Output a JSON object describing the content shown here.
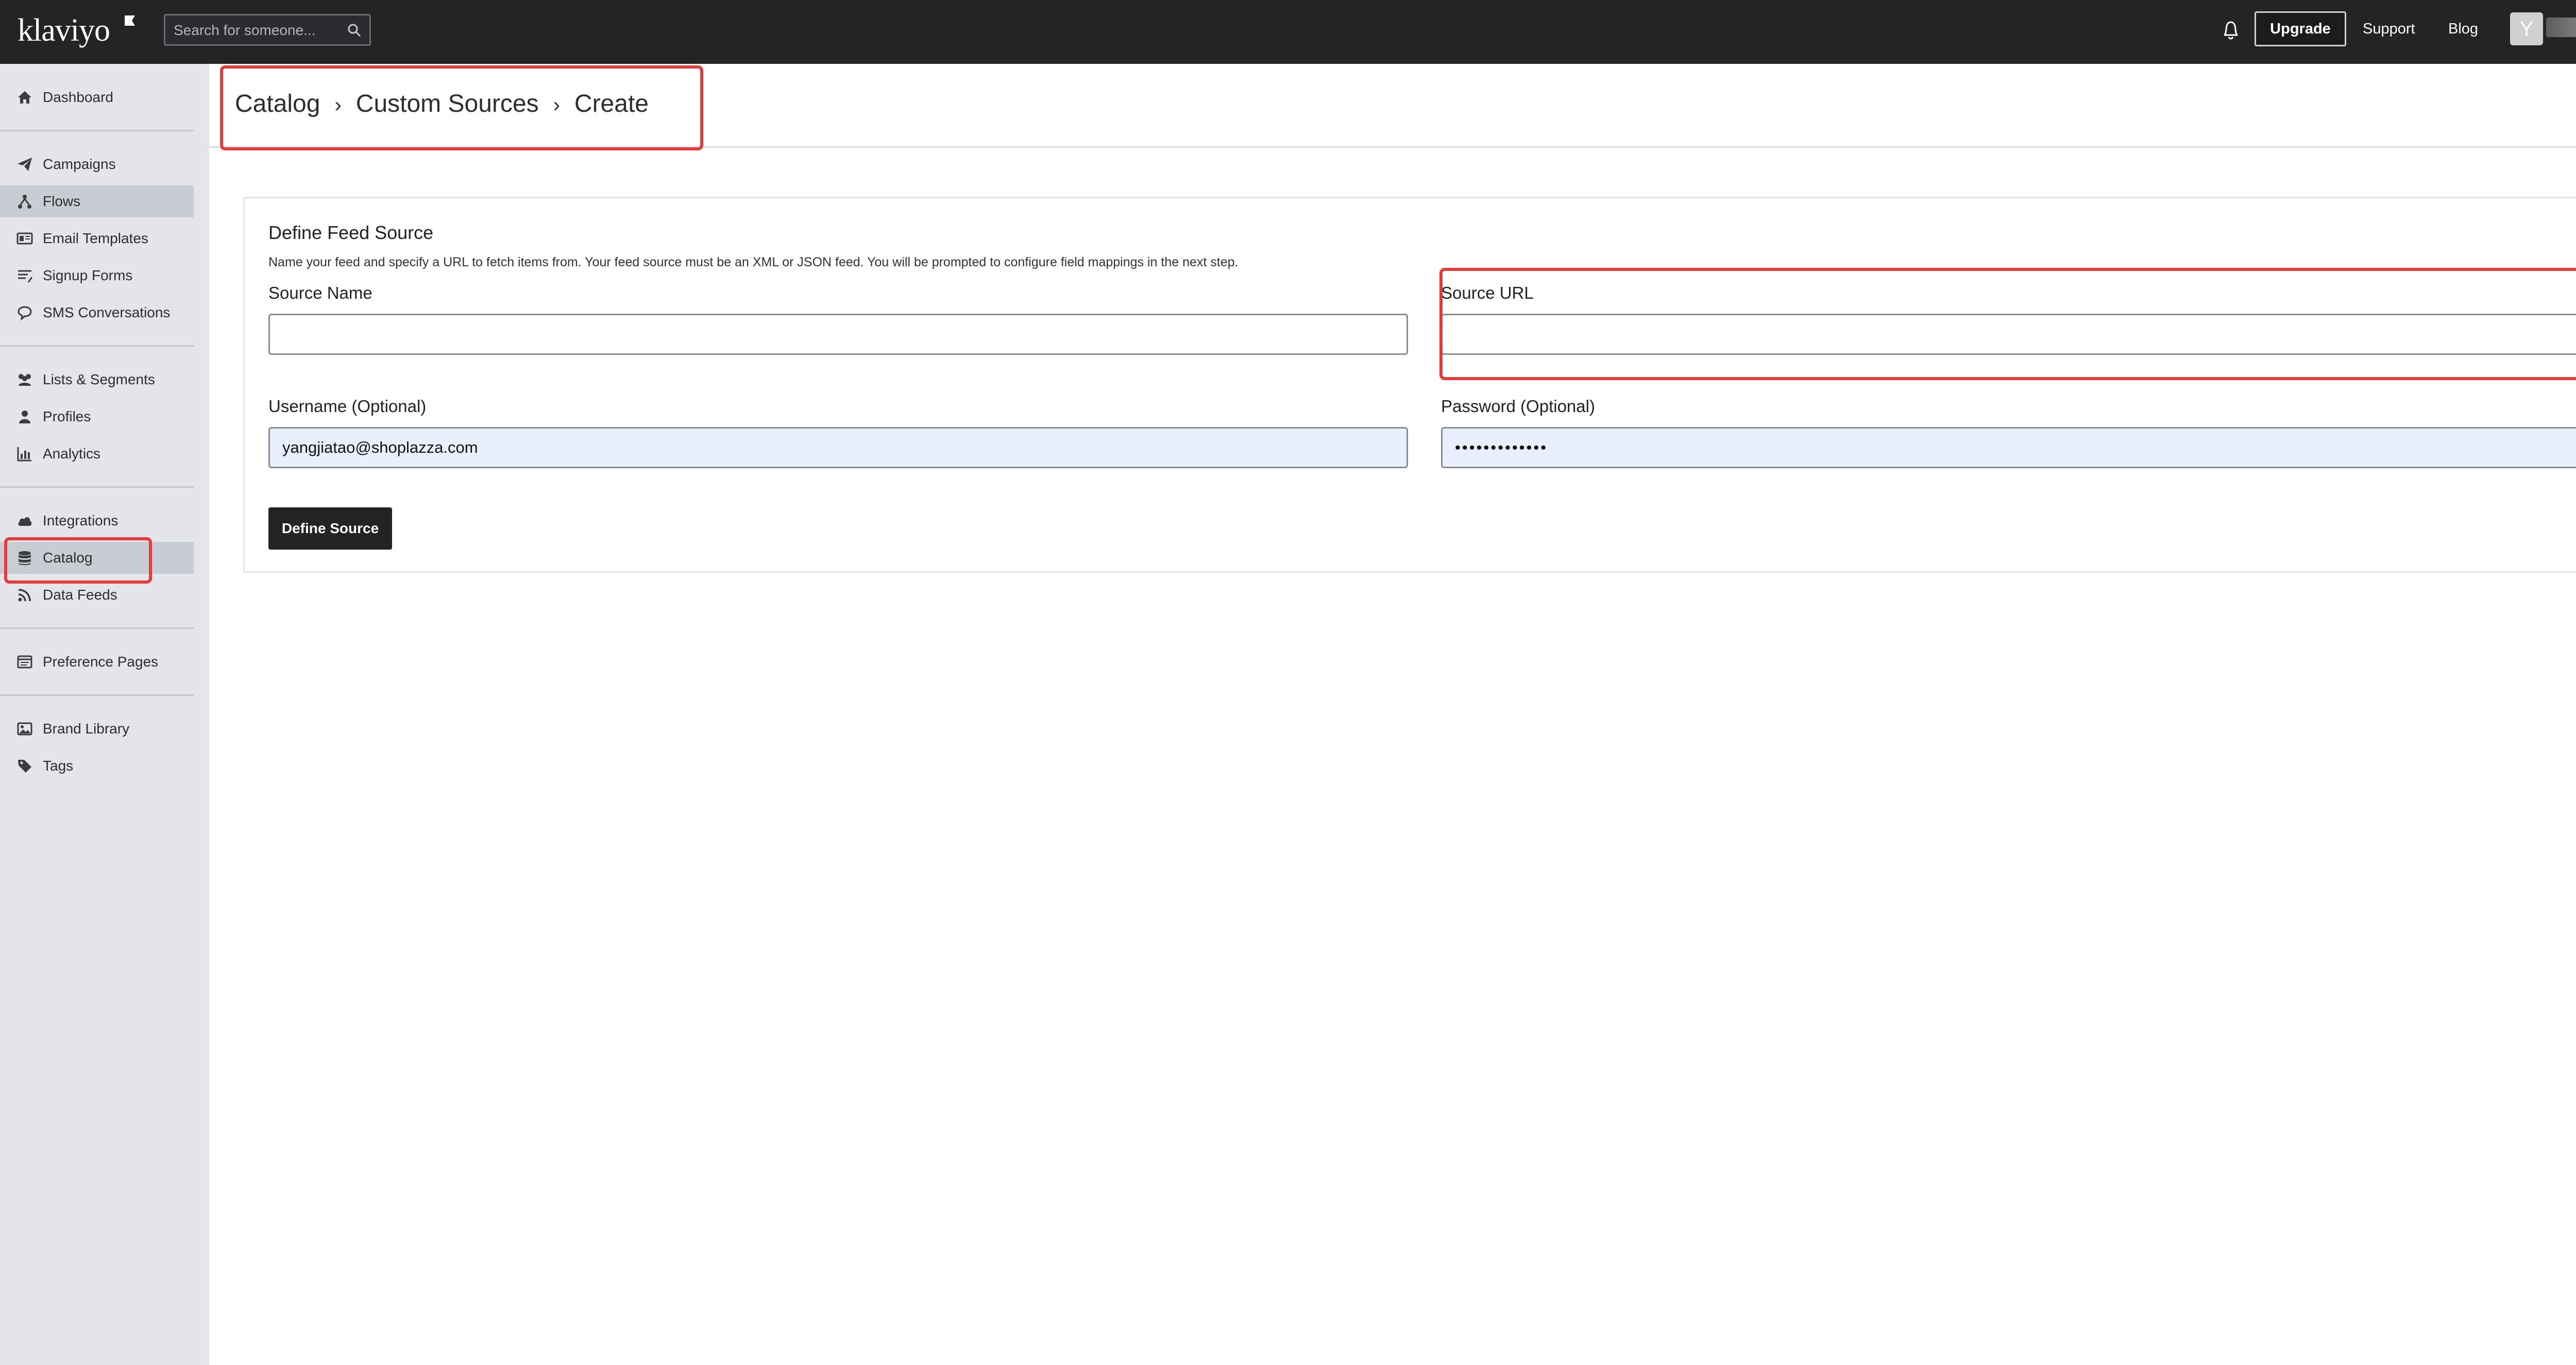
{
  "app": {
    "logo_text": "klaviyo",
    "search_placeholder": "Search for someone...",
    "upgrade_label": "Upgrade",
    "support_label": "Support",
    "blog_label": "Blog",
    "avatar_initial": "Y"
  },
  "sidebar": {
    "items": [
      {
        "label": "Dashboard",
        "icon": "home-icon"
      },
      {
        "label": "Campaigns",
        "icon": "paper-plane-icon"
      },
      {
        "label": "Flows",
        "icon": "flows-icon"
      },
      {
        "label": "Email Templates",
        "icon": "email-template-icon"
      },
      {
        "label": "Signup Forms",
        "icon": "signup-forms-icon"
      },
      {
        "label": "SMS Conversations",
        "icon": "chat-icon"
      },
      {
        "label": "Lists & Segments",
        "icon": "users-icon"
      },
      {
        "label": "Profiles",
        "icon": "user-icon"
      },
      {
        "label": "Analytics",
        "icon": "bar-chart-icon"
      },
      {
        "label": "Integrations",
        "icon": "cloud-icon"
      },
      {
        "label": "Catalog",
        "icon": "database-icon"
      },
      {
        "label": "Data Feeds",
        "icon": "rss-icon"
      },
      {
        "label": "Preference Pages",
        "icon": "preference-page-icon"
      },
      {
        "label": "Brand Library",
        "icon": "image-icon"
      },
      {
        "label": "Tags",
        "icon": "tag-icon"
      }
    ]
  },
  "breadcrumb": {
    "items": [
      "Catalog",
      "Custom Sources",
      "Create"
    ],
    "separator": "›"
  },
  "form": {
    "title": "Define Feed Source",
    "description": "Name your feed and specify a URL to fetch items from. Your feed source must be an XML or JSON feed. You will be prompted to configure field mappings in the next step.",
    "source_name_label": "Source Name",
    "source_name_value": "",
    "source_url_label": "Source URL",
    "source_url_value": "",
    "username_label": "Username (Optional)",
    "username_value": "yangjiatao@shoplazza.com",
    "password_label": "Password (Optional)",
    "password_value": "•••••••••••••",
    "submit_label": "Define Source"
  },
  "colors": {
    "topbar": "#232426",
    "sidebar": "#e3e5e8",
    "sidebar_active": "#c8ccd3",
    "annotation": "#e53b3b",
    "autofill": "#e8f0fe"
  }
}
